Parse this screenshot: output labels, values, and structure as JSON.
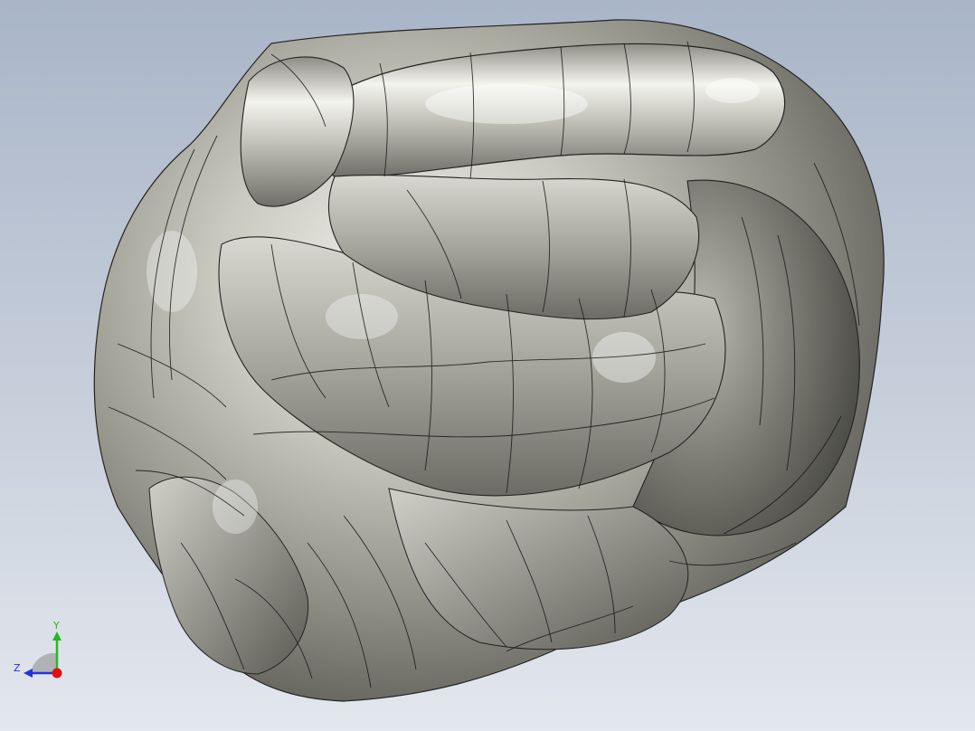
{
  "viewport": {
    "background_top": "#a9b5c8",
    "background_bottom": "#e3e7ee",
    "model": {
      "shade_light": "#e8e8e2",
      "shade_mid": "#a9a99f",
      "shade_dark": "#4e4e48",
      "edge_color": "#111111"
    }
  },
  "triad": {
    "y_label": "Y",
    "z_label": "Z",
    "y_color": "#22bb22",
    "z_color": "#2233dd",
    "x_color": "#dd1111"
  }
}
